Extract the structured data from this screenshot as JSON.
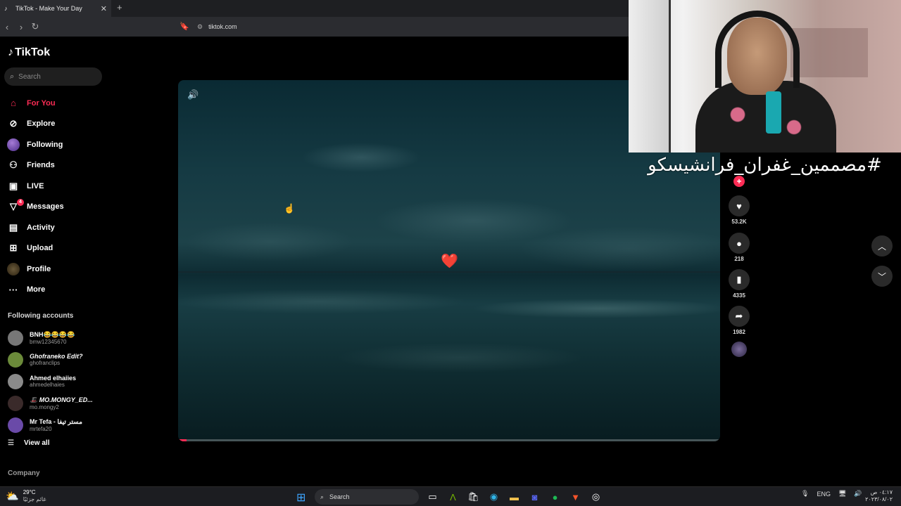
{
  "browser": {
    "tab_title": "TikTok - Make Your Day",
    "url": "tiktok.com"
  },
  "sidebar": {
    "logo": "TikTok",
    "search_placeholder": "Search",
    "nav": [
      {
        "label": "For You",
        "icon": "home-icon"
      },
      {
        "label": "Explore",
        "icon": "compass-icon"
      },
      {
        "label": "Following",
        "icon": "avatar-icon"
      },
      {
        "label": "Friends",
        "icon": "friends-icon"
      },
      {
        "label": "LIVE",
        "icon": "live-icon"
      },
      {
        "label": "Messages",
        "icon": "messages-icon",
        "badge": "4"
      },
      {
        "label": "Activity",
        "icon": "activity-icon"
      },
      {
        "label": "Upload",
        "icon": "upload-icon"
      },
      {
        "label": "Profile",
        "icon": "profile-icon"
      },
      {
        "label": "More",
        "icon": "more-icon"
      }
    ],
    "following_title": "Following accounts",
    "accounts": [
      {
        "name": "BNH😂😂😂😂",
        "username": "bmw12345670",
        "color": "#777777"
      },
      {
        "name": "Ghofraneko Edit?",
        "username": "ghofranclips",
        "color": "#6b8a3a"
      },
      {
        "name": "Ahmed elhaiies",
        "username": "ahmedelhaies",
        "color": "#8a8a8a"
      },
      {
        "name": "🎩 MO.MONGY_ED...",
        "username": "mo.mongy2",
        "color": "#3a2a2a"
      },
      {
        "name": "Mr Tefa - مستر تيفا",
        "username": "mrtefa20",
        "color": "#6a4aa8"
      }
    ],
    "view_all": "View all",
    "company": "Company"
  },
  "video": {
    "progress": 0.015,
    "counts": {
      "likes": "53.2K",
      "comments": "218",
      "saves": "4335",
      "shares": "1982"
    }
  },
  "overlay": {
    "caption": "#مصممين_غفران_فرانشيسكو"
  },
  "taskbar": {
    "temperature": "29°C",
    "condition": "غائم جزئيًا",
    "search": "Search",
    "language": "ENG",
    "time": "٠٤:١٧ ص",
    "date": "٢٠٢٣/٠٨/٠٢"
  },
  "colors": {
    "accent": "#fe2c55",
    "background": "#000000"
  }
}
